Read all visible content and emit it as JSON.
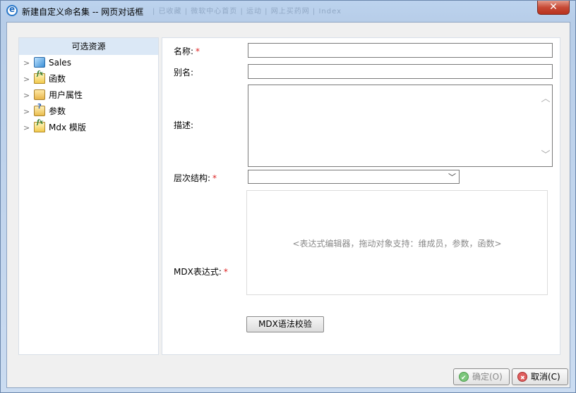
{
  "window": {
    "title": "新建自定义命名集 -- 网页对话框",
    "background_text": "| 已收藏 | 微软中心首页 | 运动 | 网上买药网 | Index"
  },
  "tree": {
    "header": "可选资源",
    "items": [
      {
        "label": "Sales",
        "icon": "cube-icon"
      },
      {
        "label": "函数",
        "icon": "function-icon"
      },
      {
        "label": "用户属性",
        "icon": "folder-icon"
      },
      {
        "label": "参数",
        "icon": "parameter-icon"
      },
      {
        "label": "Mdx 模版",
        "icon": "function-icon"
      }
    ]
  },
  "form": {
    "name_label": "名称:",
    "alias_label": "别名:",
    "description_label": "描述:",
    "hierarchy_label": "层次结构:",
    "mdx_label": "MDX表达式:",
    "required_mark": "*",
    "name_value": "",
    "alias_value": "",
    "description_value": "",
    "hierarchy_value": "",
    "mdx_placeholder": "<表达式编辑器，拖动对象支持：维成员，参数，函数>",
    "validate_button": "MDX语法校验"
  },
  "footer": {
    "ok_button": "确定(O)",
    "cancel_button": "取消(C)"
  }
}
